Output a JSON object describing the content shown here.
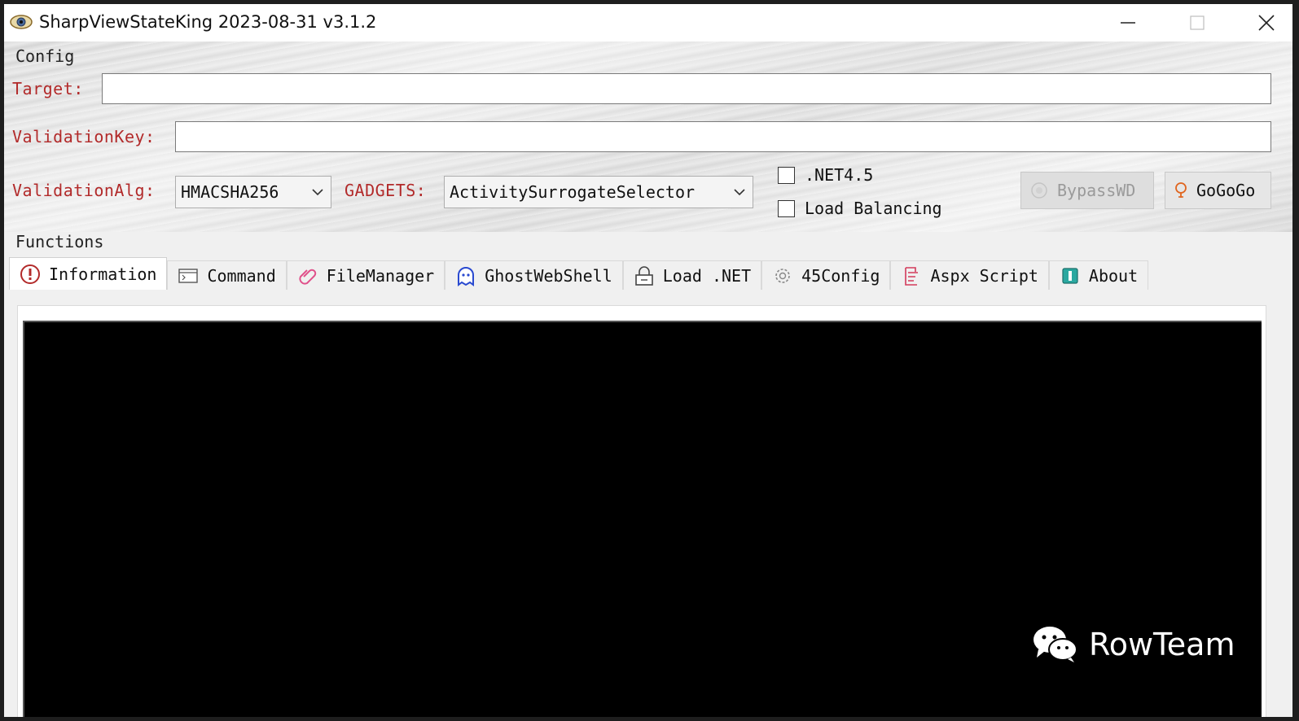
{
  "window": {
    "title": "SharpViewStateKing 2023-08-31 v3.1.2",
    "controls": {
      "minimize": "minimize-icon",
      "maximize": "maximize-icon",
      "close": "close-icon"
    }
  },
  "config": {
    "group_title": "Config",
    "target_label": "Target:",
    "target_value": "",
    "validation_key_label": "ValidationKey:",
    "validation_key_value": "",
    "validation_alg_label": "ValidationAlg:",
    "validation_alg_value": "HMACSHA256",
    "gadgets_label": "GADGETS:",
    "gadgets_value": "ActivitySurrogateSelector",
    "net45_label": ".NET4.5",
    "net45_checked": false,
    "load_balancing_label": "Load Balancing",
    "load_balancing_checked": false,
    "bypasswd_label": "BypassWD",
    "gogogo_label": "GoGoGo"
  },
  "functions": {
    "group_title": "Functions",
    "active_tab": 0,
    "tabs": [
      {
        "label": "Information",
        "icon": "info-icon"
      },
      {
        "label": "Command",
        "icon": "terminal-icon"
      },
      {
        "label": "FileManager",
        "icon": "paperclip-icon"
      },
      {
        "label": "GhostWebShell",
        "icon": "ghost-icon"
      },
      {
        "label": "Load .NET",
        "icon": "lock-icon"
      },
      {
        "label": "45Config",
        "icon": "gear-icon"
      },
      {
        "label": "Aspx Script",
        "icon": "script-icon"
      },
      {
        "label": "About",
        "icon": "book-icon"
      }
    ]
  },
  "watermark": {
    "text": "RowTeam",
    "icon": "wechat-icon"
  },
  "colors": {
    "label_red": "#b22a2a",
    "console_bg": "#000000"
  }
}
